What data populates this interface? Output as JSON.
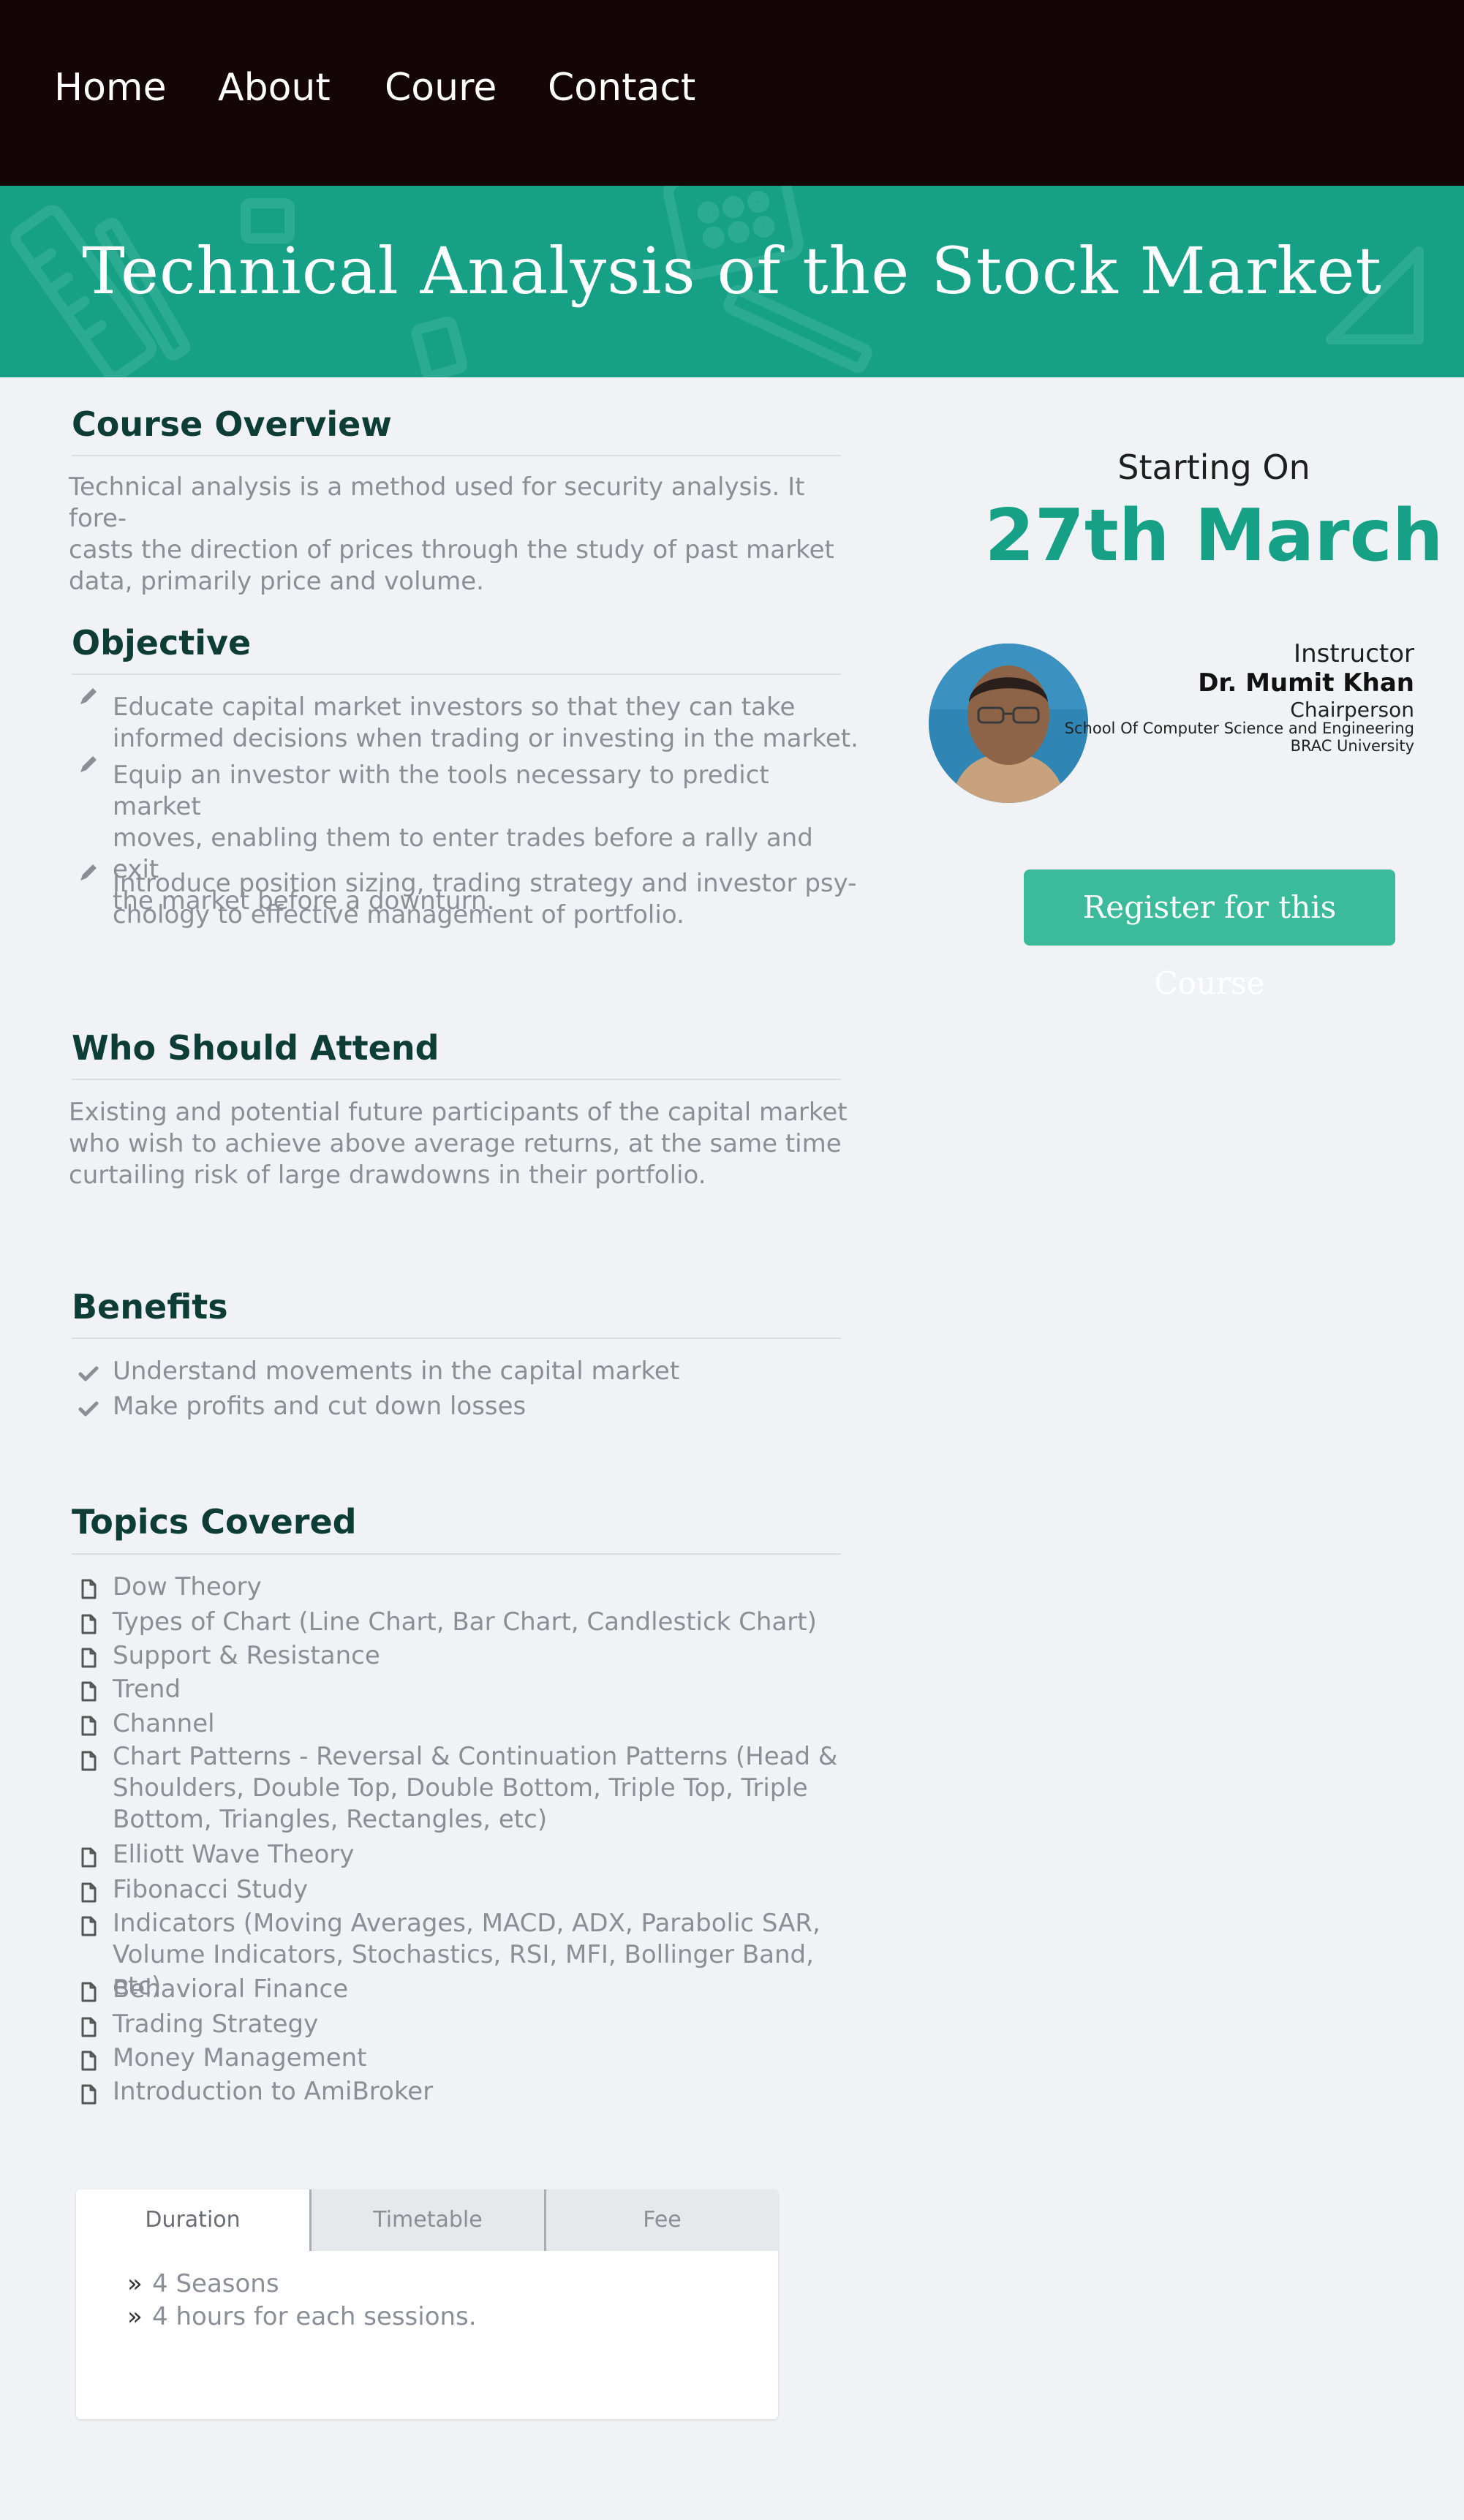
{
  "nav": {
    "items": [
      {
        "label": "Home"
      },
      {
        "label": "About"
      },
      {
        "label": "Coure"
      },
      {
        "label": "Contact"
      }
    ]
  },
  "hero": {
    "title": "Technical Analysis of the Stock Market"
  },
  "overview": {
    "heading": "Course Overview",
    "lines": [
      "Technical analysis is a method used for security analysis. It fore-",
      "casts the direction of prices through the study of past market",
      "data, primarily price and volume."
    ]
  },
  "objective": {
    "heading": "Objective",
    "items": [
      {
        "lines": [
          "Educate capital market investors so that they can take",
          "informed decisions when trading or investing in the market."
        ]
      },
      {
        "lines": [
          "Equip an investor with the tools necessary to predict market",
          "moves, enabling them to enter trades before a rally and exit",
          "the market before a downturn."
        ]
      },
      {
        "lines": [
          "Introduce position sizing, trading strategy and investor psy-",
          "chology to effective management of portfolio."
        ]
      }
    ]
  },
  "attend": {
    "heading": "Who Should Attend",
    "lines": [
      "Existing and potential future participants of the capital market",
      "who wish to achieve above average returns, at the same time",
      "curtailing risk of large drawdowns in their portfolio."
    ]
  },
  "benefits": {
    "heading": "Benefits",
    "items": [
      "Understand movements in the capital market",
      "Make profits and cut down losses"
    ]
  },
  "topics": {
    "heading": "Topics Covered",
    "items": [
      {
        "lines": [
          "Dow Theory"
        ]
      },
      {
        "lines": [
          "Types of Chart (Line Chart, Bar Chart, Candlestick Chart)"
        ]
      },
      {
        "lines": [
          "Support & Resistance"
        ]
      },
      {
        "lines": [
          "Trend"
        ]
      },
      {
        "lines": [
          "Channel"
        ]
      },
      {
        "lines": [
          "Chart Patterns - Reversal & Continuation Patterns (Head &",
          "Shoulders, Double Top, Double Bottom, Triple Top, Triple",
          "Bottom, Triangles, Rectangles, etc)"
        ]
      },
      {
        "lines": [
          "Elliott Wave Theory"
        ]
      },
      {
        "lines": [
          "Fibonacci Study"
        ]
      },
      {
        "lines": [
          "Indicators (Moving Averages, MACD, ADX, Parabolic SAR,",
          "Volume Indicators, Stochastics, RSI, MFI, Bollinger Band, etc)"
        ]
      },
      {
        "lines": [
          "Behavioral Finance"
        ]
      },
      {
        "lines": [
          "Trading Strategy"
        ]
      },
      {
        "lines": [
          "Money Management"
        ]
      },
      {
        "lines": [
          "Introduction to AmiBroker"
        ]
      }
    ]
  },
  "start": {
    "label": "Starting On",
    "date": "27th March"
  },
  "instructor": {
    "label": "Instructor",
    "name": "Dr. Mumit Khan",
    "role": "Chairperson",
    "dept": "School Of Computer Science and Engineering",
    "university": "BRAC University"
  },
  "register_label": "Register for this Course",
  "tabs": {
    "items": [
      {
        "label": "Duration"
      },
      {
        "label": "Timetable"
      },
      {
        "label": "Fee"
      }
    ],
    "active_index": 0,
    "duration_lines": [
      "4 Seasons",
      "4 hours for each sessions."
    ]
  },
  "colors": {
    "nav_bg": "#140506",
    "hero_bg": "#16a086",
    "accent": "#16a086",
    "button_bg": "#3bbb9c",
    "heading": "#0d3d35",
    "body_text": "#8a8f96",
    "page_bg": "#f0f2f5"
  },
  "icons": {
    "objective_bullet": "pencil-icon",
    "benefit_bullet": "checkmark-icon",
    "topic_bullet": "document-icon",
    "duration_bullet": "double-chevron-right-icon"
  }
}
